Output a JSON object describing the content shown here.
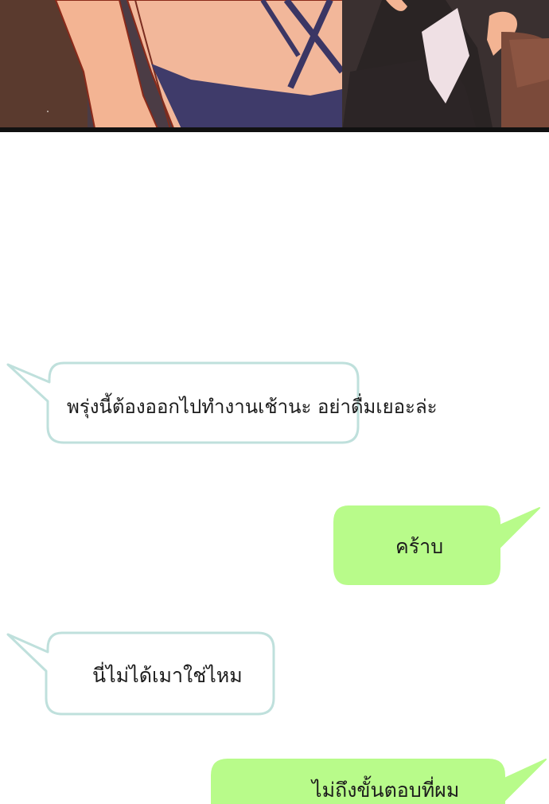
{
  "messages": [
    {
      "side": "left",
      "text": "พรุ่งนี้ต้องออกไปทำงานเช้านะ อย่าดื่มเยอะล่ะ"
    },
    {
      "side": "right",
      "text": "คร้าบ"
    },
    {
      "side": "left",
      "text": "นี่ไม่ได้เมาใช่ไหม"
    },
    {
      "side": "right",
      "text": "ไม่ถึงขั้นตอบที่ผม"
    }
  ],
  "colors": {
    "incoming_bubble_fill": "#ffffff",
    "incoming_bubble_border": "#bfe0dc",
    "outgoing_bubble_fill": "#b8fb8a",
    "panel_border": "#111111"
  }
}
